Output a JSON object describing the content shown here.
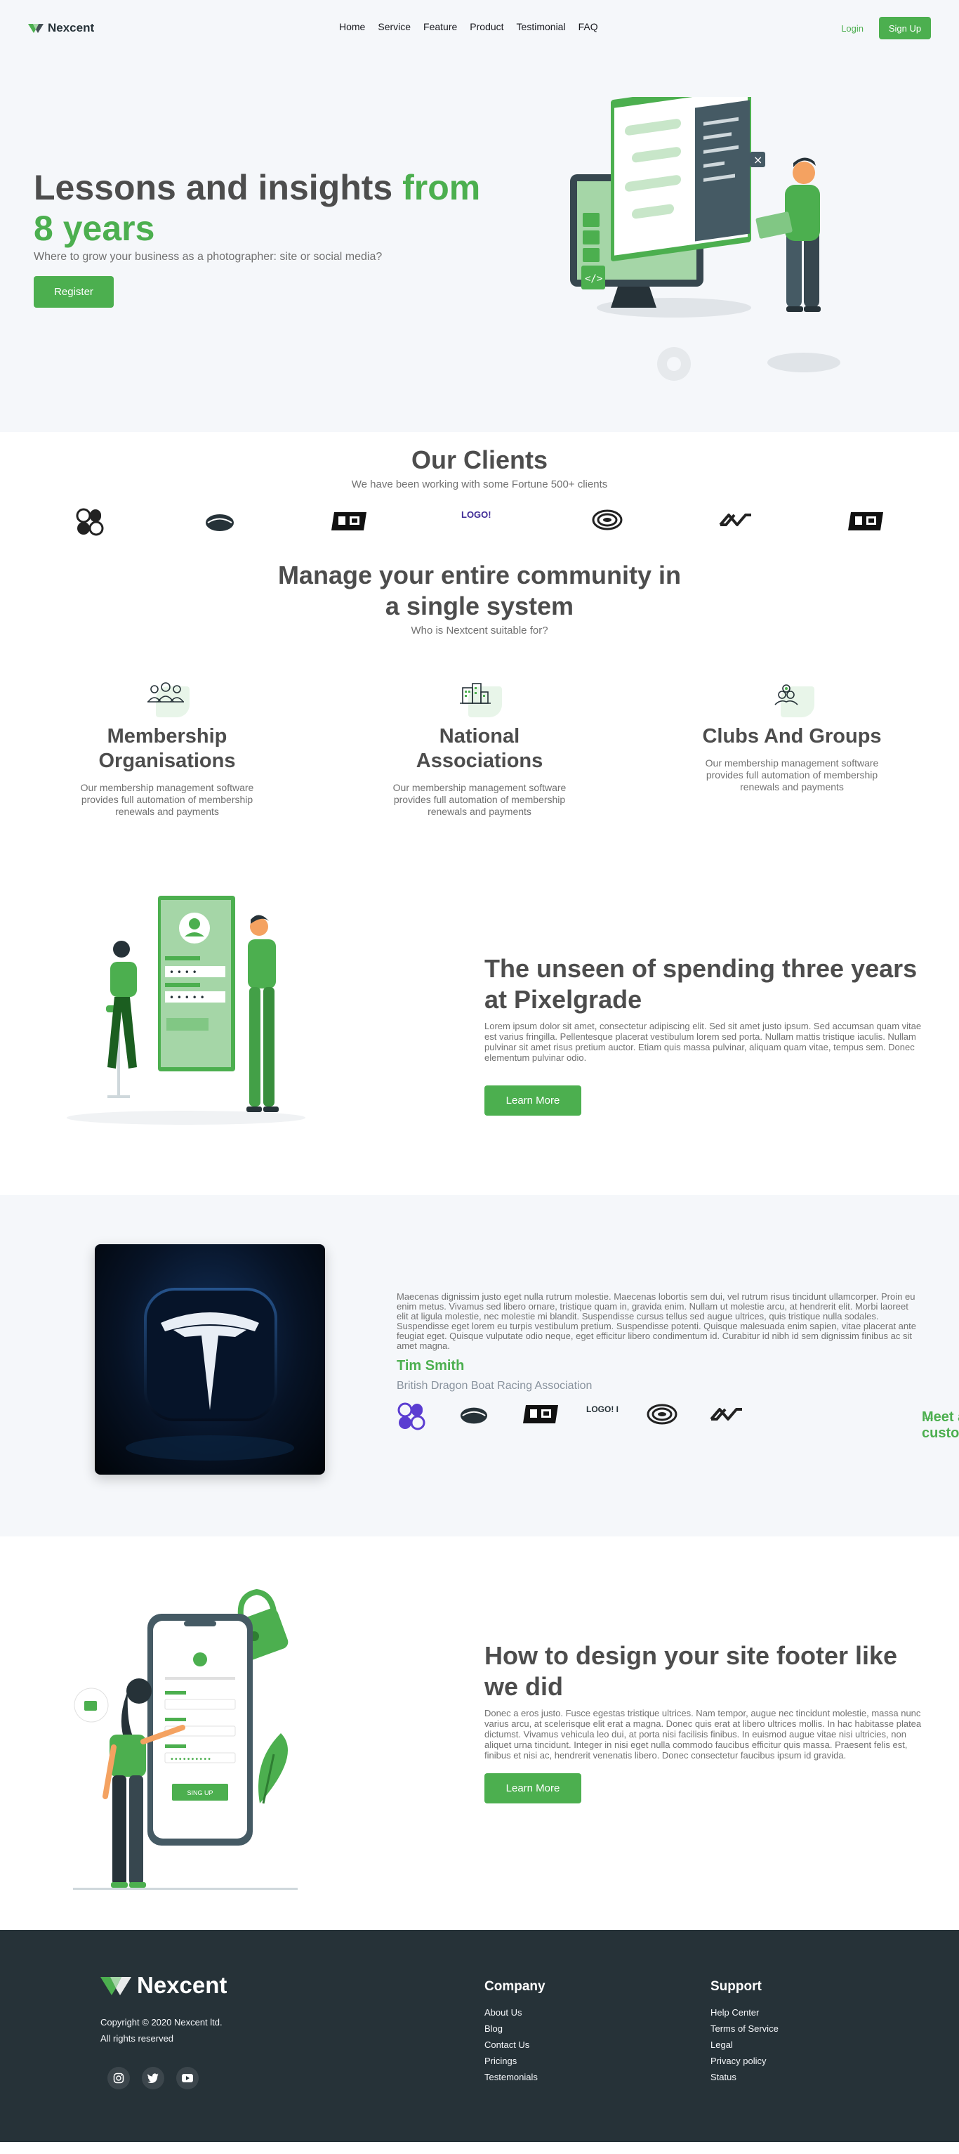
{
  "nav": {
    "brand": "Nexcent",
    "links": [
      "Home",
      "Service",
      "Feature",
      "Product",
      "Testimonial",
      "FAQ"
    ],
    "login": "Login",
    "signup": "Sign Up"
  },
  "hero": {
    "title_part1": "Lessons and insights",
    "title_part2": "from",
    "title_part3": "8 years",
    "subtitle": "Where to grow your business as a photographer: site or social media?",
    "cta": "Register"
  },
  "clients": {
    "title": "Our Clients",
    "subtitle": "We have been working with some Fortune 500+ clients",
    "logo_text": "LOGO! IPSUM"
  },
  "community": {
    "title": "Manage your entire community in a single system",
    "subtitle": "Who is Nextcent suitable for?",
    "cards": [
      {
        "title": "Membership Organisations",
        "text": "Our membership management software provides full automation of membership renewals and payments",
        "icon": "people-icon"
      },
      {
        "title": "National Associations",
        "text": "Our membership management software provides full automation of membership renewals and payments",
        "icon": "buildings-icon"
      },
      {
        "title": "Clubs And Groups",
        "text": "Our membership management software provides full automation of membership renewals and payments",
        "icon": "hand-icon"
      }
    ]
  },
  "feature1": {
    "title": "The unseen of spending three years at Pixelgrade",
    "body": "Lorem ipsum dolor sit amet, consectetur adipiscing elit. Sed sit amet justo ipsum. Sed accumsan quam vitae est varius fringilla. Pellentesque placerat vestibulum lorem sed porta. Nullam mattis tristique iaculis. Nullam pulvinar sit amet risus pretium auctor. Etiam quis massa pulvinar, aliquam quam vitae, tempus sem. Donec elementum pulvinar odio.",
    "cta": "Learn More"
  },
  "testimonial": {
    "quote": "Maecenas dignissim justo eget nulla rutrum molestie. Maecenas lobortis sem dui, vel rutrum risus tincidunt ullamcorper. Proin eu enim metus. Vivamus sed libero ornare, tristique quam in, gravida enim. Nullam ut molestie arcu, at hendrerit elit. Morbi laoreet elit at ligula molestie, nec molestie mi blandit. Suspendisse cursus tellus sed augue ultrices, quis tristique nulla sodales. Suspendisse eget lorem eu turpis vestibulum pretium. Suspendisse potenti. Quisque malesuada enim sapien, vitae placerat ante feugiat eget. Quisque vulputate odio neque, eget efficitur libero condimentum id. Curabitur id nibh id sem dignissim finibus ac sit amet magna.",
    "name": "Tim Smith",
    "org": "British Dragon Boat Racing Association",
    "meet": "Meet all customers",
    "logo_text": "LOGO! IPSUM"
  },
  "feature2": {
    "title": "How to design your site footer like we did",
    "body": "Donec a eros justo. Fusce egestas tristique ultrices. Nam tempor, augue nec tincidunt molestie, massa nunc varius arcu, at scelerisque elit erat a magna. Donec quis erat at libero ultrices mollis. In hac habitasse platea dictumst. Vivamus vehicula leo dui, at porta nisi facilisis finibus. In euismod augue vitae nisi ultricies, non aliquet urna tincidunt. Integer in nisi eget nulla commodo faucibus efficitur quis massa. Praesent felis est, finibus et nisi ac, hendrerit venenatis libero. Donec consectetur faucibus ipsum id gravida.",
    "cta": "Learn More",
    "phone_button": "SING UP"
  },
  "footer": {
    "brand": "Nexcent",
    "copyright": "Copyright © 2020 Nexcent ltd.",
    "rights": "All rights reserved",
    "company_title": "Company",
    "company_links": [
      "About Us",
      "Blog",
      "Contact Us",
      "Pricings",
      "Testemonials"
    ],
    "support_title": "Support",
    "support_links": [
      "Help Center",
      "Terms of Service",
      "Legal",
      "Privacy policy",
      "Status"
    ]
  },
  "colors": {
    "primary": "#4caf4f",
    "dark": "#263238",
    "text": "#4d4d4d",
    "muted": "#717171",
    "silver": "#f5f7fa"
  }
}
